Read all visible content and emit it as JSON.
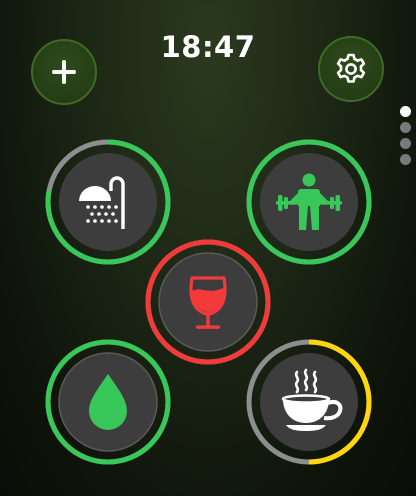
{
  "status": {
    "time": "18:47"
  },
  "header": {
    "add_icon": "plus-icon",
    "settings_icon": "gear-icon"
  },
  "pager": {
    "pages": 4,
    "active_index": 0
  },
  "colors": {
    "ring_green": "#38c759",
    "ring_red": "#f23a3a",
    "ring_yellow": "#ffd60a",
    "ring_track": "#8e8e8e",
    "button_fill": "#3d3d3d"
  },
  "habits": [
    {
      "id": "shower",
      "icon": "shower-icon",
      "status_color": "#38c759",
      "progress": 0.78
    },
    {
      "id": "workout",
      "icon": "weightlifting-icon",
      "status_color": "#38c759",
      "progress": 1.0
    },
    {
      "id": "alcohol",
      "icon": "wine-glass-icon",
      "status_color": "#f23a3a",
      "progress": 1.0
    },
    {
      "id": "water",
      "icon": "water-drop-icon",
      "status_color": "#38c759",
      "progress": 1.0
    },
    {
      "id": "coffee",
      "icon": "coffee-cup-icon",
      "status_color": "#ffd60a",
      "progress": 0.5
    }
  ]
}
